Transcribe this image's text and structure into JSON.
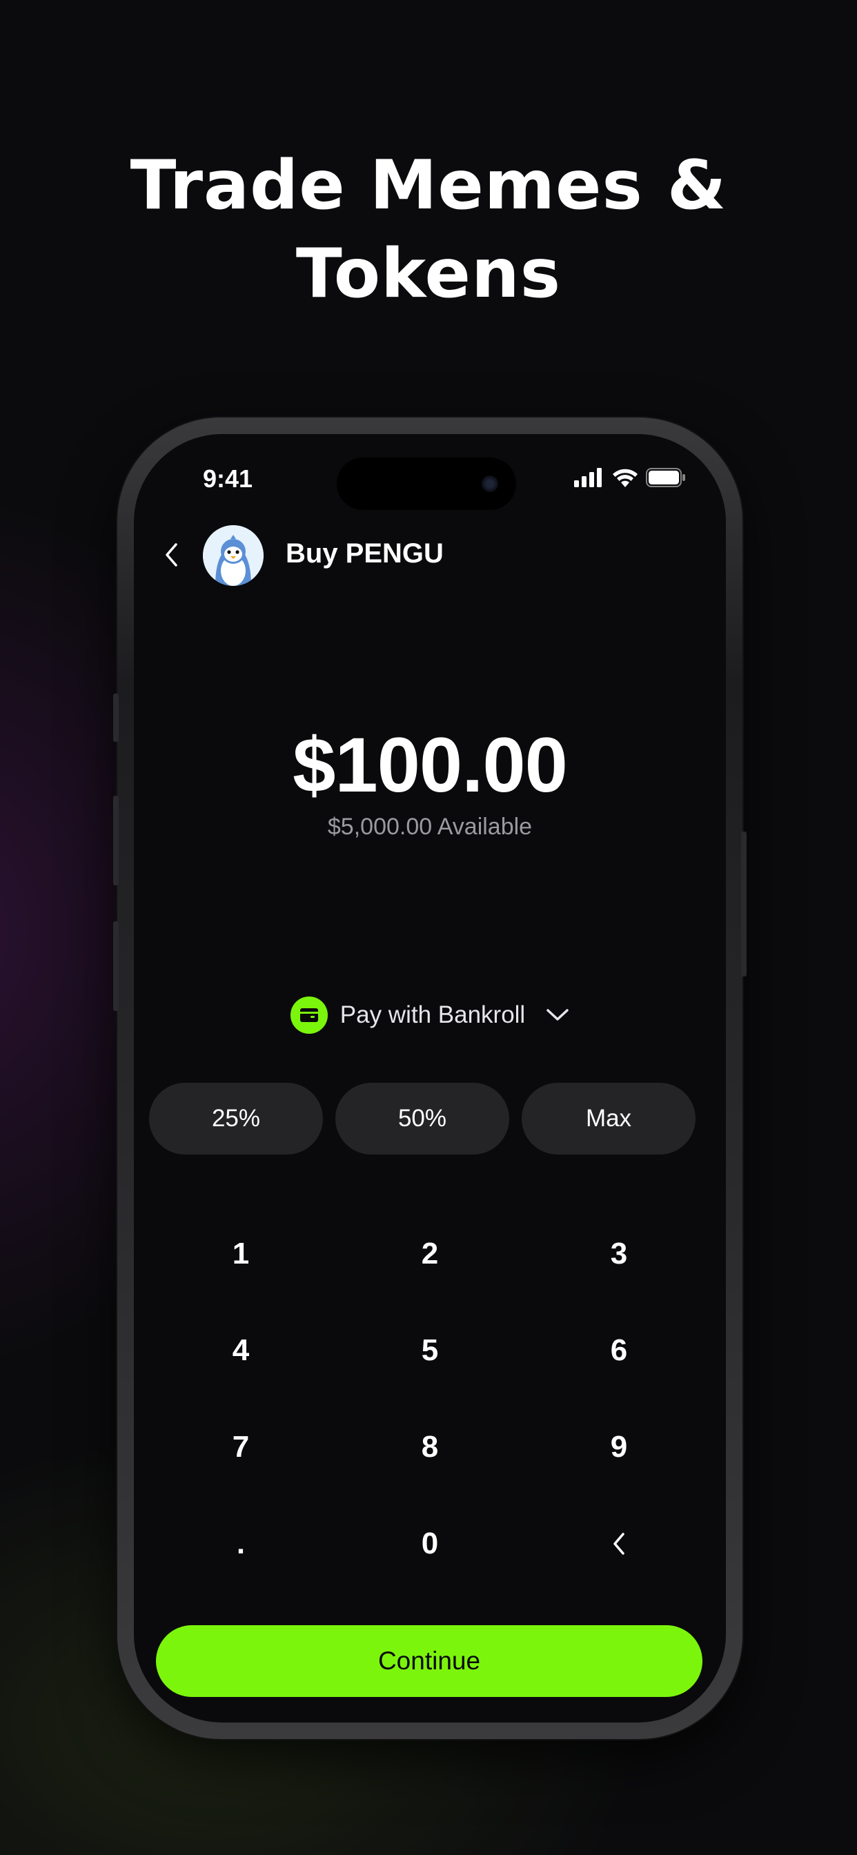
{
  "headline": {
    "line1": "Trade Memes &",
    "line2": "Tokens"
  },
  "status_bar": {
    "time": "9:41",
    "icons": [
      "signal-icon",
      "wifi-icon",
      "battery-icon"
    ]
  },
  "nav": {
    "back_icon": "chevron-left-icon",
    "avatar": "pengu-avatar",
    "title": "Buy PENGU"
  },
  "amount": {
    "value": "$100.00",
    "available": "$5,000.00 Available"
  },
  "payment": {
    "icon": "wallet-icon",
    "label": "Pay with Bankroll",
    "dropdown_icon": "chevron-down-icon"
  },
  "presets": [
    "25%",
    "50%",
    "Max"
  ],
  "keypad": {
    "rows": [
      [
        "1",
        "2",
        "3"
      ],
      [
        "4",
        "5",
        "6"
      ],
      [
        "7",
        "8",
        "9"
      ],
      [
        ".",
        "0",
        "backspace-icon"
      ]
    ]
  },
  "continue_label": "Continue",
  "colors": {
    "accent": "#7CF50C",
    "background": "#0A0A0C",
    "pill": "#242427",
    "muted_text": "#9A9AA0"
  }
}
